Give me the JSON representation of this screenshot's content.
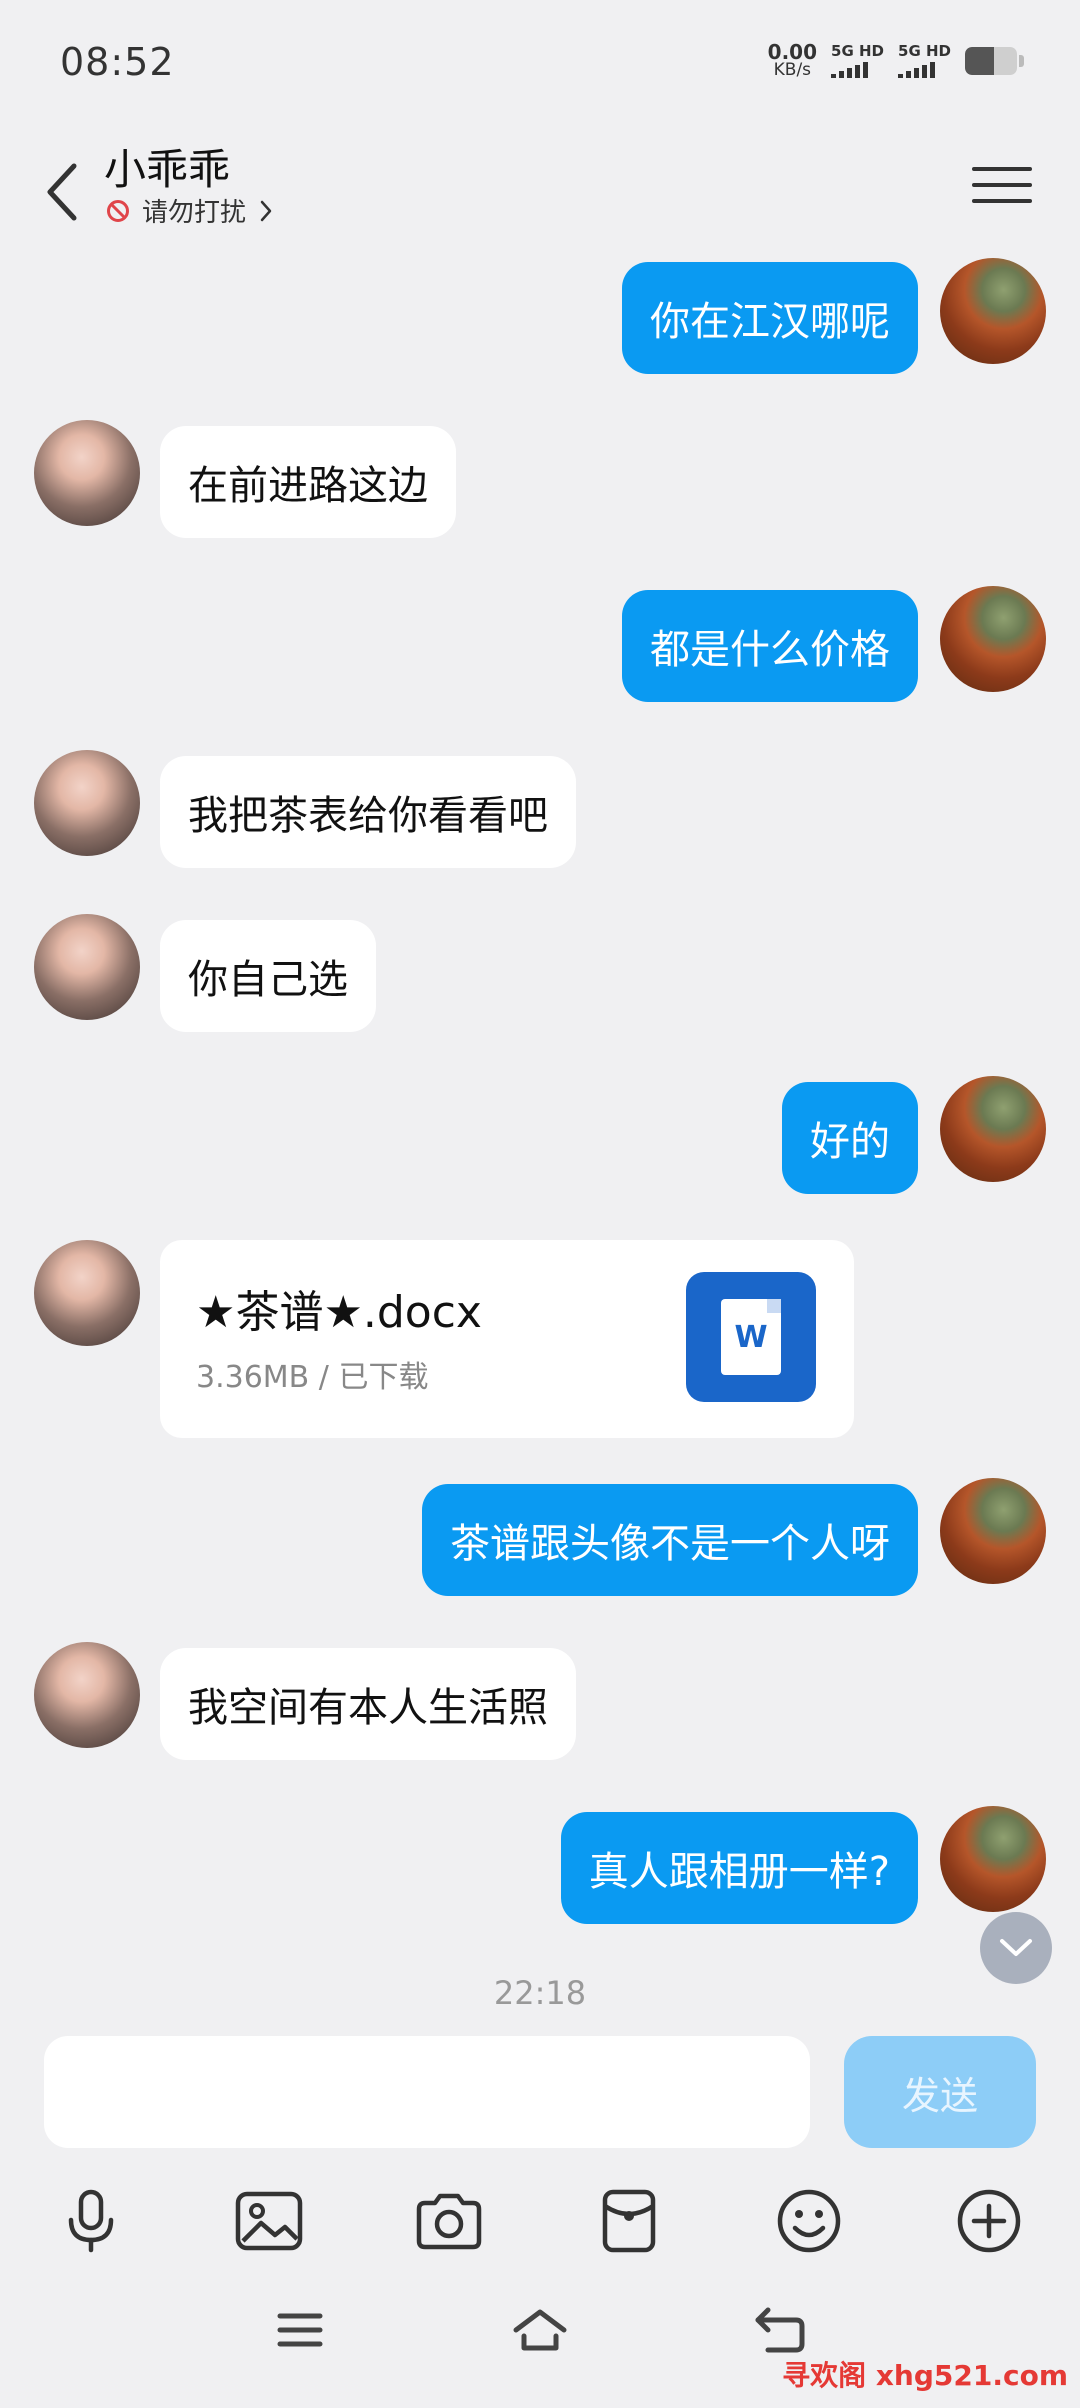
{
  "status_bar": {
    "time": "08:52",
    "net_speed_value": "0.00",
    "net_speed_unit": "KB/s",
    "sim1_label": "5G HD",
    "sim2_label": "5G HD",
    "battery_level": 0.55
  },
  "header": {
    "contact_name": "小乖乖",
    "status_text": "请勿打扰"
  },
  "messages": [
    {
      "from": "self",
      "text": "你在江汉哪呢"
    },
    {
      "from": "other",
      "text": "在前进路这边"
    },
    {
      "from": "self",
      "text": "都是什么价格"
    },
    {
      "from": "other",
      "text": "我把茶表给你看看吧"
    },
    {
      "from": "other",
      "text": "你自己选"
    },
    {
      "from": "self",
      "text": "好的"
    },
    {
      "from": "other",
      "type": "file",
      "file_name": "★茶谱★.docx",
      "file_meta": "3.36MB / 已下载",
      "file_icon_letter": "W"
    },
    {
      "from": "self",
      "text": "茶谱跟头像不是一个人呀"
    },
    {
      "from": "other",
      "text": "我空间有本人生活照"
    },
    {
      "from": "self",
      "text": "真人跟相册一样?"
    }
  ],
  "timestamp": "22:18",
  "input": {
    "value": "",
    "placeholder": "",
    "send_label": "发送"
  },
  "toolbar_icons": [
    "microphone-icon",
    "image-icon",
    "camera-icon",
    "red-packet-icon",
    "emoji-icon",
    "plus-icon"
  ],
  "nav_icons": [
    "menu-icon",
    "home-icon",
    "back-icon"
  ],
  "watermark": "寻欢阁 xhg521.com",
  "colors": {
    "self_bubble": "#0a9af2",
    "other_bubble": "#ffffff",
    "background": "#f0f0f2",
    "send_button": "#8dcdf7",
    "doc_icon": "#1a66c9"
  }
}
